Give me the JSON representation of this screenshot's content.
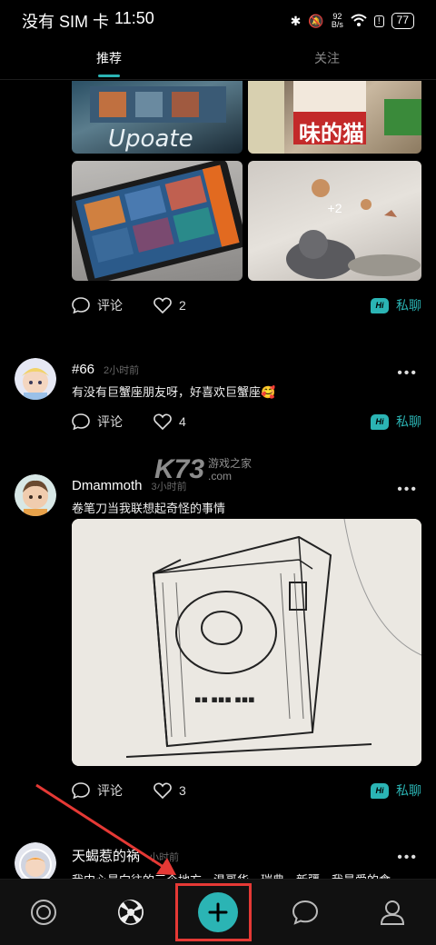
{
  "status_bar": {
    "carrier": "没有 SIM 卡",
    "time": "11:50",
    "speed_value": "92",
    "speed_unit": "B/s",
    "battery": "77"
  },
  "tabs": [
    {
      "label": "推荐",
      "active": true
    },
    {
      "label": "关注",
      "active": false
    }
  ],
  "posts": [
    {
      "comment_label": "评论",
      "likes": "2",
      "chat_label": "私聊",
      "grid_more": "+2"
    },
    {
      "username": "#66",
      "time": "2小时前",
      "text": "有没有巨蟹座朋友呀，好喜欢巨蟹座🥰",
      "comment_label": "评论",
      "likes": "4",
      "chat_label": "私聊"
    },
    {
      "username": "Dmammoth",
      "time": "3小时前",
      "text": "卷笔刀当我联想起奇怪的事情",
      "comment_label": "评论",
      "likes": "3",
      "chat_label": "私聊"
    },
    {
      "username": "天蝎惹的祸",
      "time": "小时前",
      "text": "我内心最向往的三个地方，温哥华，瑞典，新疆，我最爱的食"
    }
  ],
  "watermark": {
    "logo": "K73",
    "text": "游戏之家",
    "sub": ".com"
  },
  "bottom_nav": [
    {
      "name": "home",
      "icon": "target-icon"
    },
    {
      "name": "discover",
      "icon": "aperture-icon"
    },
    {
      "name": "add",
      "icon": "plus-icon"
    },
    {
      "name": "messages",
      "icon": "chat-bubble-icon"
    },
    {
      "name": "profile",
      "icon": "person-icon"
    }
  ],
  "colors": {
    "accent": "#2bb4b4",
    "annotation": "#e53935"
  }
}
